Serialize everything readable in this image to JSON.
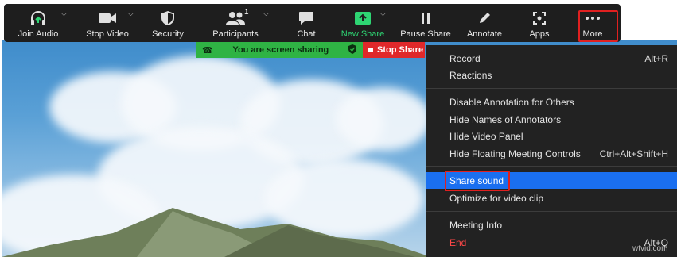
{
  "toolbar": {
    "join_audio": "Join Audio",
    "stop_video": "Stop Video",
    "security": "Security",
    "participants": "Participants",
    "participant_count": "1",
    "chat": "Chat",
    "new_share": "New Share",
    "pause_share": "Pause Share",
    "annotate": "Annotate",
    "apps": "Apps",
    "more": "More"
  },
  "sharing_bar": {
    "status": "You are screen sharing",
    "stop_label": "Stop Share"
  },
  "menu": {
    "record": {
      "label": "Record",
      "shortcut": "Alt+R"
    },
    "reactions": {
      "label": "Reactions"
    },
    "disable_annotation": {
      "label": "Disable Annotation for Others"
    },
    "hide_names": {
      "label": "Hide Names of Annotators"
    },
    "hide_video": {
      "label": "Hide Video Panel"
    },
    "hide_floating": {
      "label": "Hide Floating Meeting Controls",
      "shortcut": "Ctrl+Alt+Shift+H"
    },
    "share_sound": {
      "label": "Share sound"
    },
    "optimize_video": {
      "label": "Optimize for video clip"
    },
    "meeting_info": {
      "label": "Meeting Info"
    },
    "end": {
      "label": "End",
      "shortcut": "Alt+Q"
    }
  },
  "watermark": "wtvid.com",
  "colors": {
    "toolbar_bg": "#1e1e1e",
    "menu_bg": "#222222",
    "selected": "#1a6ff0",
    "highlight_outline": "#e02020",
    "sharing_green": "#2fb344",
    "stop_red": "#e0282a",
    "new_share_green": "#2ed573"
  }
}
